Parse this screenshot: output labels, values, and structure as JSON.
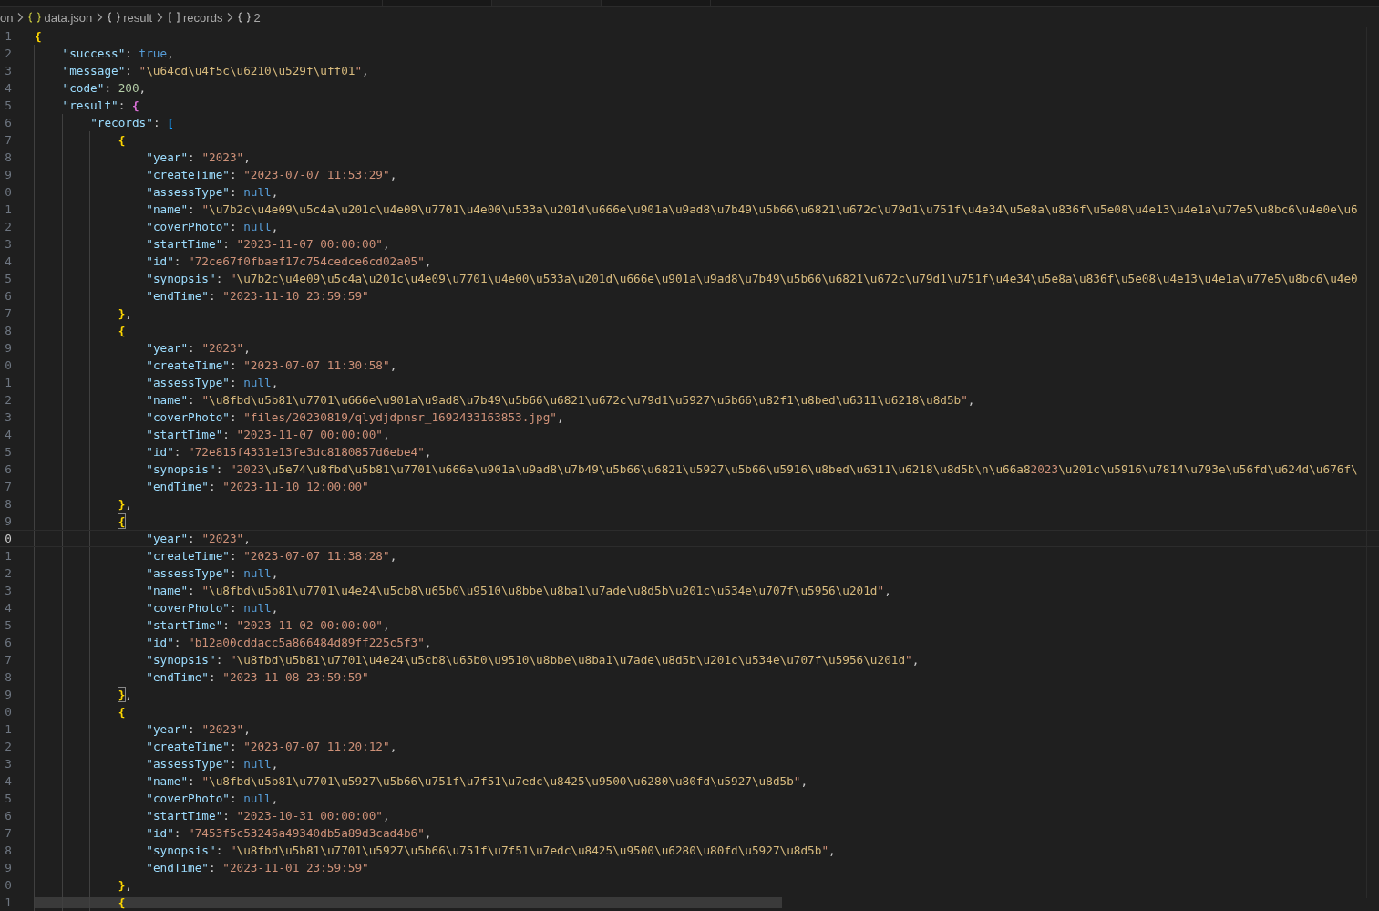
{
  "breadcrumb": [
    {
      "label": "on",
      "kind": "plain"
    },
    {
      "label": "data.json",
      "kind": "file"
    },
    {
      "label": "result",
      "kind": "object"
    },
    {
      "label": "records",
      "kind": "array"
    },
    {
      "label": "2",
      "kind": "object"
    }
  ],
  "lines": [
    {
      "number": "1",
      "current": false,
      "tokens": [
        {
          "kind": "open",
          "text": "{"
        }
      ]
    },
    {
      "number": "2",
      "current": false,
      "tokens": [
        {
          "kind": "key",
          "text": "\"success\""
        },
        {
          "kind": "punct",
          "text": ": "
        },
        {
          "kind": "keyword",
          "text": "true"
        },
        {
          "kind": "punct",
          "text": ","
        }
      ]
    },
    {
      "number": "3",
      "current": false,
      "tokens": [
        {
          "kind": "key",
          "text": "\"message\""
        },
        {
          "kind": "punct",
          "text": ": "
        },
        {
          "kind": "string",
          "text": "\"\\u64cd\\u4f5c\\u6210\\u529f\\uff01\""
        },
        {
          "kind": "punct",
          "text": ","
        }
      ]
    },
    {
      "number": "4",
      "current": false,
      "tokens": [
        {
          "kind": "key",
          "text": "\"code\""
        },
        {
          "kind": "punct",
          "text": ": "
        },
        {
          "kind": "number",
          "text": "200"
        },
        {
          "kind": "punct",
          "text": ","
        }
      ]
    },
    {
      "number": "5",
      "current": false,
      "tokens": [
        {
          "kind": "key",
          "text": "\"result\""
        },
        {
          "kind": "punct",
          "text": ": "
        },
        {
          "kind": "open",
          "text": "{"
        }
      ]
    },
    {
      "number": "6",
      "current": false,
      "tokens": [
        {
          "kind": "key",
          "text": "\"records\""
        },
        {
          "kind": "punct",
          "text": ": "
        },
        {
          "kind": "open",
          "text": "["
        }
      ]
    },
    {
      "number": "7",
      "current": false,
      "tokens": [
        {
          "kind": "open",
          "text": "{"
        }
      ]
    },
    {
      "number": "8",
      "current": false,
      "tokens": [
        {
          "kind": "key",
          "text": "\"year\""
        },
        {
          "kind": "punct",
          "text": ": "
        },
        {
          "kind": "string",
          "text": "\"2023\""
        },
        {
          "kind": "punct",
          "text": ","
        }
      ]
    },
    {
      "number": "9",
      "current": false,
      "tokens": [
        {
          "kind": "key",
          "text": "\"createTime\""
        },
        {
          "kind": "punct",
          "text": ": "
        },
        {
          "kind": "string",
          "text": "\"2023-07-07 11:53:29\""
        },
        {
          "kind": "punct",
          "text": ","
        }
      ]
    },
    {
      "number": "0",
      "current": false,
      "tokens": [
        {
          "kind": "key",
          "text": "\"assessType\""
        },
        {
          "kind": "punct",
          "text": ": "
        },
        {
          "kind": "keyword",
          "text": "null"
        },
        {
          "kind": "punct",
          "text": ","
        }
      ]
    },
    {
      "number": "1",
      "current": false,
      "tokens": [
        {
          "kind": "key",
          "text": "\"name\""
        },
        {
          "kind": "punct",
          "text": ": "
        },
        {
          "kind": "string",
          "text": "\"\\u7b2c\\u4e09\\u5c4a\\u201c\\u4e09\\u7701\\u4e00\\u533a\\u201d\\u666e\\u901a\\u9ad8\\u7b49\\u5b66\\u6821\\u672c\\u79d1\\u751f\\u4e34\\u5e8a\\u836f\\u5e08\\u4e13\\u4e1a\\u77e5\\u8bc6\\u4e0e\\u6"
        }
      ]
    },
    {
      "number": "2",
      "current": false,
      "tokens": [
        {
          "kind": "key",
          "text": "\"coverPhoto\""
        },
        {
          "kind": "punct",
          "text": ": "
        },
        {
          "kind": "keyword",
          "text": "null"
        },
        {
          "kind": "punct",
          "text": ","
        }
      ]
    },
    {
      "number": "3",
      "current": false,
      "tokens": [
        {
          "kind": "key",
          "text": "\"startTime\""
        },
        {
          "kind": "punct",
          "text": ": "
        },
        {
          "kind": "string",
          "text": "\"2023-11-07 00:00:00\""
        },
        {
          "kind": "punct",
          "text": ","
        }
      ]
    },
    {
      "number": "4",
      "current": false,
      "tokens": [
        {
          "kind": "key",
          "text": "\"id\""
        },
        {
          "kind": "punct",
          "text": ": "
        },
        {
          "kind": "string",
          "text": "\"72ce67f0fbaef17c754cedce6cd02a05\""
        },
        {
          "kind": "punct",
          "text": ","
        }
      ]
    },
    {
      "number": "5",
      "current": false,
      "tokens": [
        {
          "kind": "key",
          "text": "\"synopsis\""
        },
        {
          "kind": "punct",
          "text": ": "
        },
        {
          "kind": "string",
          "text": "\"\\u7b2c\\u4e09\\u5c4a\\u201c\\u4e09\\u7701\\u4e00\\u533a\\u201d\\u666e\\u901a\\u9ad8\\u7b49\\u5b66\\u6821\\u672c\\u79d1\\u751f\\u4e34\\u5e8a\\u836f\\u5e08\\u4e13\\u4e1a\\u77e5\\u8bc6\\u4e0"
        }
      ]
    },
    {
      "number": "6",
      "current": false,
      "tokens": [
        {
          "kind": "key",
          "text": "\"endTime\""
        },
        {
          "kind": "punct",
          "text": ": "
        },
        {
          "kind": "string",
          "text": "\"2023-11-10 23:59:59\""
        }
      ]
    },
    {
      "number": "7",
      "current": false,
      "tokens": [
        {
          "kind": "close",
          "text": "}"
        },
        {
          "kind": "punct",
          "text": ","
        }
      ]
    },
    {
      "number": "8",
      "current": false,
      "tokens": [
        {
          "kind": "open",
          "text": "{"
        }
      ]
    },
    {
      "number": "9",
      "current": false,
      "tokens": [
        {
          "kind": "key",
          "text": "\"year\""
        },
        {
          "kind": "punct",
          "text": ": "
        },
        {
          "kind": "string",
          "text": "\"2023\""
        },
        {
          "kind": "punct",
          "text": ","
        }
      ]
    },
    {
      "number": "0",
      "current": false,
      "tokens": [
        {
          "kind": "key",
          "text": "\"createTime\""
        },
        {
          "kind": "punct",
          "text": ": "
        },
        {
          "kind": "string",
          "text": "\"2023-07-07 11:30:58\""
        },
        {
          "kind": "punct",
          "text": ","
        }
      ]
    },
    {
      "number": "1",
      "current": false,
      "tokens": [
        {
          "kind": "key",
          "text": "\"assessType\""
        },
        {
          "kind": "punct",
          "text": ": "
        },
        {
          "kind": "keyword",
          "text": "null"
        },
        {
          "kind": "punct",
          "text": ","
        }
      ]
    },
    {
      "number": "2",
      "current": false,
      "tokens": [
        {
          "kind": "key",
          "text": "\"name\""
        },
        {
          "kind": "punct",
          "text": ": "
        },
        {
          "kind": "string",
          "text": "\"\\u8fbd\\u5b81\\u7701\\u666e\\u901a\\u9ad8\\u7b49\\u5b66\\u6821\\u672c\\u79d1\\u5927\\u5b66\\u82f1\\u8bed\\u6311\\u6218\\u8d5b\""
        },
        {
          "kind": "punct",
          "text": ","
        }
      ]
    },
    {
      "number": "3",
      "current": false,
      "tokens": [
        {
          "kind": "key",
          "text": "\"coverPhoto\""
        },
        {
          "kind": "punct",
          "text": ": "
        },
        {
          "kind": "string",
          "text": "\"files/20230819/qlydjdpnsr_1692433163853.jpg\""
        },
        {
          "kind": "punct",
          "text": ","
        }
      ]
    },
    {
      "number": "4",
      "current": false,
      "tokens": [
        {
          "kind": "key",
          "text": "\"startTime\""
        },
        {
          "kind": "punct",
          "text": ": "
        },
        {
          "kind": "string",
          "text": "\"2023-11-07 00:00:00\""
        },
        {
          "kind": "punct",
          "text": ","
        }
      ]
    },
    {
      "number": "5",
      "current": false,
      "tokens": [
        {
          "kind": "key",
          "text": "\"id\""
        },
        {
          "kind": "punct",
          "text": ": "
        },
        {
          "kind": "string",
          "text": "\"72e815f4331e13fe3dc8180857d6ebe4\""
        },
        {
          "kind": "punct",
          "text": ","
        }
      ]
    },
    {
      "number": "6",
      "current": false,
      "tokens": [
        {
          "kind": "key",
          "text": "\"synopsis\""
        },
        {
          "kind": "punct",
          "text": ": "
        },
        {
          "kind": "string",
          "text": "\"2023\\u5e74\\u8fbd\\u5b81\\u7701\\u666e\\u901a\\u9ad8\\u7b49\\u5b66\\u6821\\u5927\\u5b66\\u5916\\u8bed\\u6311\\u6218\\u8d5b\\n\\u66a82023\\u201c\\u5916\\u7814\\u793e\\u56fd\\u624d\\u676f\\"
        }
      ]
    },
    {
      "number": "7",
      "current": false,
      "tokens": [
        {
          "kind": "key",
          "text": "\"endTime\""
        },
        {
          "kind": "punct",
          "text": ": "
        },
        {
          "kind": "string",
          "text": "\"2023-11-10 12:00:00\""
        }
      ]
    },
    {
      "number": "8",
      "current": false,
      "tokens": [
        {
          "kind": "close",
          "text": "}"
        },
        {
          "kind": "punct",
          "text": ","
        }
      ]
    },
    {
      "number": "9",
      "current": false,
      "tokens": [
        {
          "kind": "open",
          "text": "{",
          "matched": true
        }
      ]
    },
    {
      "number": "0",
      "current": true,
      "tokens": [
        {
          "kind": "key",
          "text": "\"year\""
        },
        {
          "kind": "punct",
          "text": ": "
        },
        {
          "kind": "string",
          "text": "\"2023\""
        },
        {
          "kind": "punct",
          "text": ","
        }
      ]
    },
    {
      "number": "1",
      "current": false,
      "tokens": [
        {
          "kind": "key",
          "text": "\"createTime\""
        },
        {
          "kind": "punct",
          "text": ": "
        },
        {
          "kind": "string",
          "text": "\"2023-07-07 11:38:28\""
        },
        {
          "kind": "punct",
          "text": ","
        }
      ]
    },
    {
      "number": "2",
      "current": false,
      "tokens": [
        {
          "kind": "key",
          "text": "\"assessType\""
        },
        {
          "kind": "punct",
          "text": ": "
        },
        {
          "kind": "keyword",
          "text": "null"
        },
        {
          "kind": "punct",
          "text": ","
        }
      ]
    },
    {
      "number": "3",
      "current": false,
      "tokens": [
        {
          "kind": "key",
          "text": "\"name\""
        },
        {
          "kind": "punct",
          "text": ": "
        },
        {
          "kind": "string",
          "text": "\"\\u8fbd\\u5b81\\u7701\\u4e24\\u5cb8\\u65b0\\u9510\\u8bbe\\u8ba1\\u7ade\\u8d5b\\u201c\\u534e\\u707f\\u5956\\u201d\""
        },
        {
          "kind": "punct",
          "text": ","
        }
      ]
    },
    {
      "number": "4",
      "current": false,
      "tokens": [
        {
          "kind": "key",
          "text": "\"coverPhoto\""
        },
        {
          "kind": "punct",
          "text": ": "
        },
        {
          "kind": "keyword",
          "text": "null"
        },
        {
          "kind": "punct",
          "text": ","
        }
      ]
    },
    {
      "number": "5",
      "current": false,
      "tokens": [
        {
          "kind": "key",
          "text": "\"startTime\""
        },
        {
          "kind": "punct",
          "text": ": "
        },
        {
          "kind": "string",
          "text": "\"2023-11-02 00:00:00\""
        },
        {
          "kind": "punct",
          "text": ","
        }
      ]
    },
    {
      "number": "6",
      "current": false,
      "tokens": [
        {
          "kind": "key",
          "text": "\"id\""
        },
        {
          "kind": "punct",
          "text": ": "
        },
        {
          "kind": "string",
          "text": "\"b12a00cddacc5a866484d89ff225c5f3\""
        },
        {
          "kind": "punct",
          "text": ","
        }
      ]
    },
    {
      "number": "7",
      "current": false,
      "tokens": [
        {
          "kind": "key",
          "text": "\"synopsis\""
        },
        {
          "kind": "punct",
          "text": ": "
        },
        {
          "kind": "string",
          "text": "\"\\u8fbd\\u5b81\\u7701\\u4e24\\u5cb8\\u65b0\\u9510\\u8bbe\\u8ba1\\u7ade\\u8d5b\\u201c\\u534e\\u707f\\u5956\\u201d\""
        },
        {
          "kind": "punct",
          "text": ","
        }
      ]
    },
    {
      "number": "8",
      "current": false,
      "tokens": [
        {
          "kind": "key",
          "text": "\"endTime\""
        },
        {
          "kind": "punct",
          "text": ": "
        },
        {
          "kind": "string",
          "text": "\"2023-11-08 23:59:59\""
        }
      ]
    },
    {
      "number": "9",
      "current": false,
      "tokens": [
        {
          "kind": "close",
          "text": "}",
          "matched": true
        },
        {
          "kind": "punct",
          "text": ","
        }
      ]
    },
    {
      "number": "0",
      "current": false,
      "tokens": [
        {
          "kind": "open",
          "text": "{"
        }
      ]
    },
    {
      "number": "1",
      "current": false,
      "tokens": [
        {
          "kind": "key",
          "text": "\"year\""
        },
        {
          "kind": "punct",
          "text": ": "
        },
        {
          "kind": "string",
          "text": "\"2023\""
        },
        {
          "kind": "punct",
          "text": ","
        }
      ]
    },
    {
      "number": "2",
      "current": false,
      "tokens": [
        {
          "kind": "key",
          "text": "\"createTime\""
        },
        {
          "kind": "punct",
          "text": ": "
        },
        {
          "kind": "string",
          "text": "\"2023-07-07 11:20:12\""
        },
        {
          "kind": "punct",
          "text": ","
        }
      ]
    },
    {
      "number": "3",
      "current": false,
      "tokens": [
        {
          "kind": "key",
          "text": "\"assessType\""
        },
        {
          "kind": "punct",
          "text": ": "
        },
        {
          "kind": "keyword",
          "text": "null"
        },
        {
          "kind": "punct",
          "text": ","
        }
      ]
    },
    {
      "number": "4",
      "current": false,
      "tokens": [
        {
          "kind": "key",
          "text": "\"name\""
        },
        {
          "kind": "punct",
          "text": ": "
        },
        {
          "kind": "string",
          "text": "\"\\u8fbd\\u5b81\\u7701\\u5927\\u5b66\\u751f\\u7f51\\u7edc\\u8425\\u9500\\u6280\\u80fd\\u5927\\u8d5b\""
        },
        {
          "kind": "punct",
          "text": ","
        }
      ]
    },
    {
      "number": "5",
      "current": false,
      "tokens": [
        {
          "kind": "key",
          "text": "\"coverPhoto\""
        },
        {
          "kind": "punct",
          "text": ": "
        },
        {
          "kind": "keyword",
          "text": "null"
        },
        {
          "kind": "punct",
          "text": ","
        }
      ]
    },
    {
      "number": "6",
      "current": false,
      "tokens": [
        {
          "kind": "key",
          "text": "\"startTime\""
        },
        {
          "kind": "punct",
          "text": ": "
        },
        {
          "kind": "string",
          "text": "\"2023-10-31 00:00:00\""
        },
        {
          "kind": "punct",
          "text": ","
        }
      ]
    },
    {
      "number": "7",
      "current": false,
      "tokens": [
        {
          "kind": "key",
          "text": "\"id\""
        },
        {
          "kind": "punct",
          "text": ": "
        },
        {
          "kind": "string",
          "text": "\"7453f5c53246a49340db5a89d3cad4b6\""
        },
        {
          "kind": "punct",
          "text": ","
        }
      ]
    },
    {
      "number": "8",
      "current": false,
      "tokens": [
        {
          "kind": "key",
          "text": "\"synopsis\""
        },
        {
          "kind": "punct",
          "text": ": "
        },
        {
          "kind": "string",
          "text": "\"\\u8fbd\\u5b81\\u7701\\u5927\\u5b66\\u751f\\u7f51\\u7edc\\u8425\\u9500\\u6280\\u80fd\\u5927\\u8d5b\""
        },
        {
          "kind": "punct",
          "text": ","
        }
      ]
    },
    {
      "number": "9",
      "current": false,
      "tokens": [
        {
          "kind": "key",
          "text": "\"endTime\""
        },
        {
          "kind": "punct",
          "text": ": "
        },
        {
          "kind": "string",
          "text": "\"2023-11-01 23:59:59\""
        }
      ]
    },
    {
      "number": "0",
      "current": false,
      "tokens": [
        {
          "kind": "close",
          "text": "}"
        },
        {
          "kind": "punct",
          "text": ","
        }
      ]
    },
    {
      "number": "1",
      "current": false,
      "tokens": [
        {
          "kind": "open",
          "text": "{"
        }
      ]
    }
  ]
}
